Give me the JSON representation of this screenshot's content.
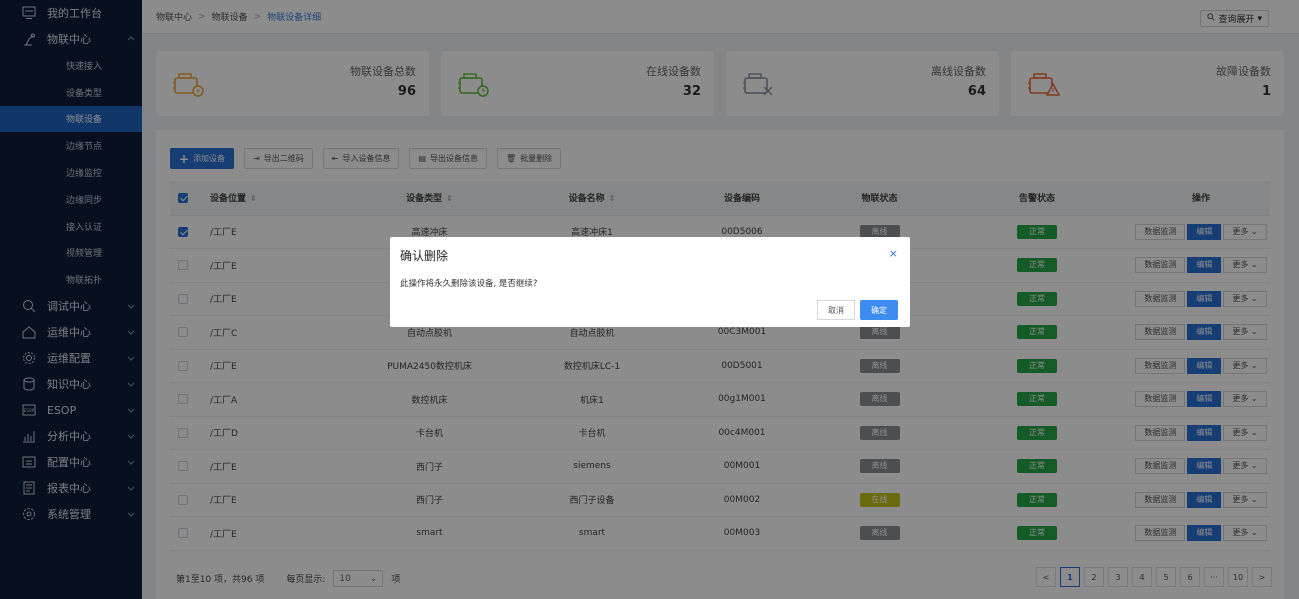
{
  "sidebar": {
    "groups": [
      {
        "label": "我的工作台",
        "icon": "dashboard-icon"
      },
      {
        "label": "物联中心",
        "icon": "robot-arm-icon",
        "expanded": true
      },
      {
        "label": "调试中心",
        "icon": "debug-icon"
      },
      {
        "label": "运维中心",
        "icon": "maintenance-icon"
      },
      {
        "label": "运维配置",
        "icon": "gear-icon"
      },
      {
        "label": "知识中心",
        "icon": "knowledge-icon"
      },
      {
        "label": "ESOP",
        "icon": "esop-icon"
      },
      {
        "label": "分析中心",
        "icon": "analytics-icon"
      },
      {
        "label": "配置中心",
        "icon": "config-icon"
      },
      {
        "label": "报表中心",
        "icon": "report-icon"
      },
      {
        "label": "系统管理",
        "icon": "system-gear-icon"
      }
    ],
    "sub_items": [
      "快速接入",
      "设备类型",
      "物联设备",
      "边缘节点",
      "边缘监控",
      "边缘同步",
      "接入认证",
      "视频管理",
      "物联拓扑"
    ],
    "active_sub": "物联设备"
  },
  "breadcrumb": [
    "物联中心",
    "物联设备",
    "物联设备详细"
  ],
  "query_button": "查询展开",
  "stats": [
    {
      "label": "物联设备总数",
      "value": "96",
      "color": "#f0a23b"
    },
    {
      "label": "在线设备数",
      "value": "32",
      "color": "#5bbf3b"
    },
    {
      "label": "离线设备数",
      "value": "64",
      "color": "#8a94a3"
    },
    {
      "label": "故障设备数",
      "value": "1",
      "color": "#ea6a3a"
    }
  ],
  "toolbar": {
    "add": "添加设备",
    "export_qr": "导出二维码",
    "import_info": "导入设备信息",
    "export_info": "导出设备信息",
    "batch_delete": "批量删除"
  },
  "table": {
    "headers": [
      "设备位置",
      "设备类型",
      "设备名称",
      "设备编码",
      "物联状态",
      "告警状态",
      "操作"
    ],
    "rows": [
      {
        "location": "/工厂E",
        "type": "高速冲床",
        "name": "高速冲床1",
        "code": "00D5006",
        "iot": "离线",
        "alarm": "正常",
        "checked": true
      },
      {
        "location": "/工厂E",
        "type": "",
        "name": "",
        "code": "",
        "iot": "",
        "alarm": "正常",
        "checked": false
      },
      {
        "location": "/工厂E",
        "type": "",
        "name": "",
        "code": "",
        "iot": "",
        "alarm": "正常",
        "checked": false
      },
      {
        "location": "/工厂C",
        "type": "自动点胶机",
        "name": "自动点胶机",
        "code": "00C3M001",
        "iot": "离线",
        "alarm": "正常",
        "checked": false
      },
      {
        "location": "/工厂E",
        "type": "PUMA2450数控机床",
        "name": "数控机床LC-1",
        "code": "00D5001",
        "iot": "离线",
        "alarm": "正常",
        "checked": false
      },
      {
        "location": "/工厂A",
        "type": "数控机床",
        "name": "机床1",
        "code": "00g1M001",
        "iot": "离线",
        "alarm": "正常",
        "checked": false
      },
      {
        "location": "/工厂D",
        "type": "卡台机",
        "name": "卡台机",
        "code": "00c4M001",
        "iot": "离线",
        "alarm": "正常",
        "checked": false
      },
      {
        "location": "/工厂E",
        "type": "西门子",
        "name": "siemens",
        "code": "00M001",
        "iot": "离线",
        "alarm": "正常",
        "checked": false
      },
      {
        "location": "/工厂E",
        "type": "西门子",
        "name": "西门子设备",
        "code": "00M002",
        "iot": "在线",
        "alarm": "正常",
        "checked": false
      },
      {
        "location": "/工厂E",
        "type": "smart",
        "name": "smart",
        "code": "00M003",
        "iot": "离线",
        "alarm": "正常",
        "checked": false
      }
    ],
    "ops": {
      "monitor": "数据监测",
      "edit": "编辑",
      "more": "更多"
    },
    "colors": {
      "offline": "#8d8f94",
      "online": "#c3c21a",
      "normal": "#27a74a"
    }
  },
  "footer": {
    "summary": "第1至10 项，共96 项",
    "per_page_label": "每页显示:",
    "per_page": "10",
    "unit": "项"
  },
  "pagination": [
    "<",
    "1",
    "2",
    "3",
    "4",
    "5",
    "6",
    "···",
    "10",
    ">"
  ],
  "modal": {
    "title": "确认删除",
    "message": "此操作将永久删除该设备, 是否继续?",
    "cancel": "取消",
    "confirm": "确定",
    "close": "×"
  }
}
